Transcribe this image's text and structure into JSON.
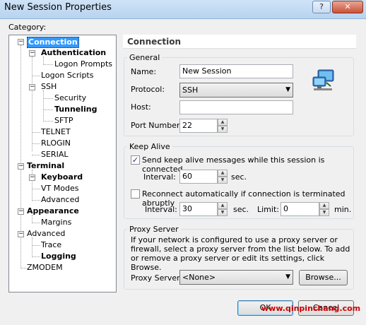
{
  "window": {
    "title": "New Session Properties",
    "help_label": "?",
    "close_label": "✕"
  },
  "category": {
    "label": "Category:",
    "items": {
      "connection": "Connection",
      "authentication": "Authentication",
      "logon_prompts": "Logon Prompts",
      "logon_scripts": "Logon Scripts",
      "ssh": "SSH",
      "security": "Security",
      "tunneling": "Tunneling",
      "sftp": "SFTP",
      "telnet": "TELNET",
      "rlogin": "RLOGIN",
      "serial": "SERIAL",
      "terminal": "Terminal",
      "keyboard": "Keyboard",
      "vt_modes": "VT Modes",
      "advanced_terminal": "Advanced",
      "appearance": "Appearance",
      "margins": "Margins",
      "advanced": "Advanced",
      "trace": "Trace",
      "logging": "Logging",
      "zmodem": "ZMODEM"
    }
  },
  "panel": {
    "header": "Connection",
    "general": {
      "label": "General",
      "name_label": "Name:",
      "name_value": "New Session",
      "protocol_label": "Protocol:",
      "protocol_value": "SSH",
      "host_label": "Host:",
      "host_value": "",
      "port_label": "Port Number:",
      "port_value": "22"
    },
    "keep_alive": {
      "label": "Keep Alive",
      "send_label": "Send keep alive messages while this session is connected",
      "send_checked": true,
      "interval_label": "Interval:",
      "interval_value": "60",
      "sec_label": "sec.",
      "reconnect_label": "Reconnect automatically if connection is terminated abruptly",
      "reconnect_checked": false,
      "reconnect_interval_label": "Interval:",
      "reconnect_interval_value": "30",
      "reconnect_sec_label": "sec.",
      "limit_label": "Limit:",
      "limit_value": "0",
      "min_label": "min."
    },
    "proxy": {
      "label": "Proxy Server",
      "description": "If your network is configured to use a proxy server or firewall, select a proxy server from the list below. To add or remove a proxy server or edit its settings, click Browse.",
      "server_label": "Proxy Server:",
      "server_value": "<None>",
      "browse_label": "Browse..."
    }
  },
  "footer": {
    "ok_label": "OK",
    "cancel_label": "Cancel",
    "watermark": "www.qinpinchang.com"
  },
  "icons": {
    "network": "network-computers-icon"
  }
}
